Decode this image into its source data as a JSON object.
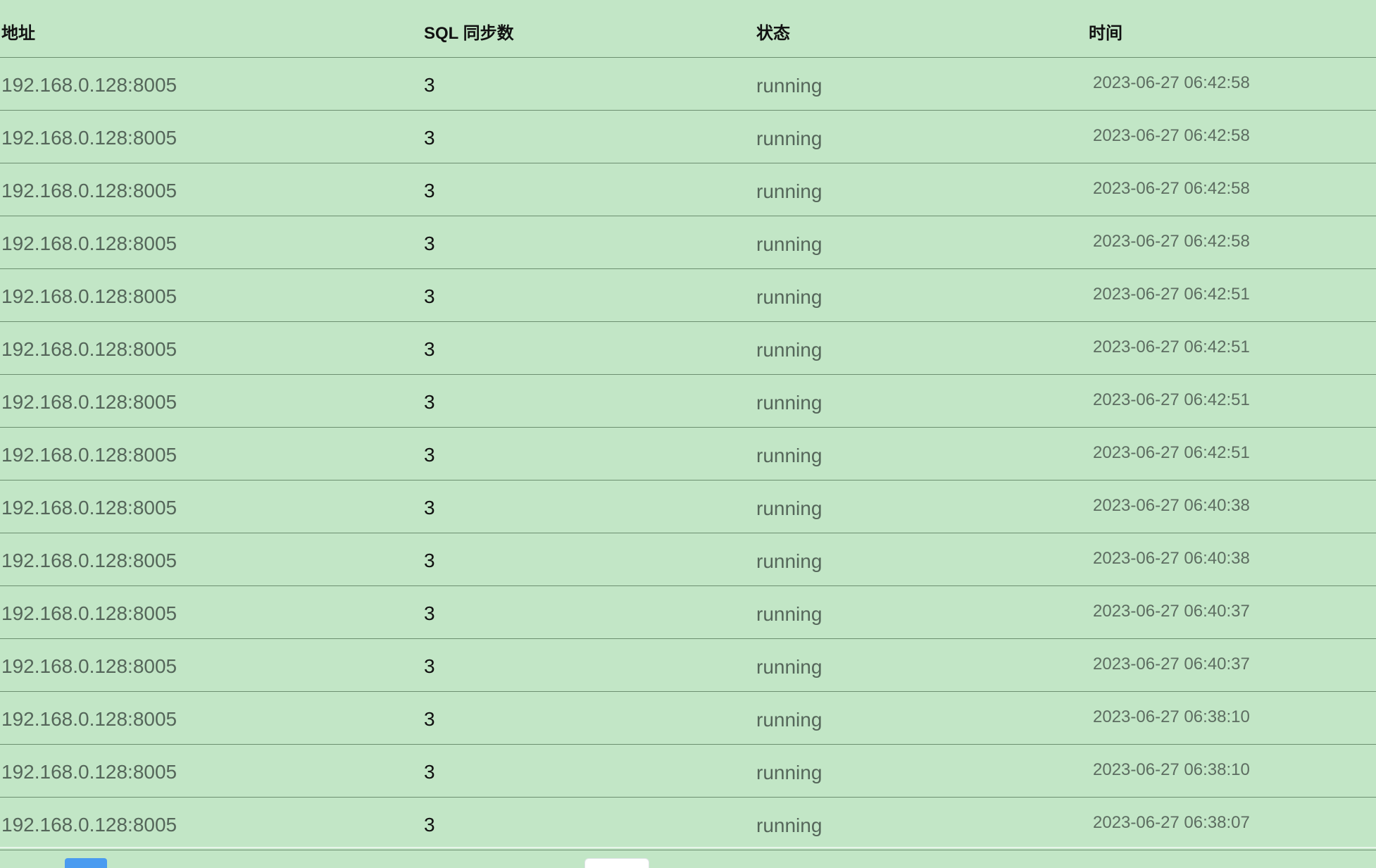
{
  "table": {
    "headers": {
      "address": "地址",
      "sql_sync_count": "SQL 同步数",
      "status": "状态",
      "time": "时间"
    },
    "rows": [
      {
        "address": "192.168.0.128:8005",
        "sql_sync_count": "3",
        "status": "running",
        "time": "2023-06-27 06:42:58"
      },
      {
        "address": "192.168.0.128:8005",
        "sql_sync_count": "3",
        "status": "running",
        "time": "2023-06-27 06:42:58"
      },
      {
        "address": "192.168.0.128:8005",
        "sql_sync_count": "3",
        "status": "running",
        "time": "2023-06-27 06:42:58"
      },
      {
        "address": "192.168.0.128:8005",
        "sql_sync_count": "3",
        "status": "running",
        "time": "2023-06-27 06:42:58"
      },
      {
        "address": "192.168.0.128:8005",
        "sql_sync_count": "3",
        "status": "running",
        "time": "2023-06-27 06:42:51"
      },
      {
        "address": "192.168.0.128:8005",
        "sql_sync_count": "3",
        "status": "running",
        "time": "2023-06-27 06:42:51"
      },
      {
        "address": "192.168.0.128:8005",
        "sql_sync_count": "3",
        "status": "running",
        "time": "2023-06-27 06:42:51"
      },
      {
        "address": "192.168.0.128:8005",
        "sql_sync_count": "3",
        "status": "running",
        "time": "2023-06-27 06:42:51"
      },
      {
        "address": "192.168.0.128:8005",
        "sql_sync_count": "3",
        "status": "running",
        "time": "2023-06-27 06:40:38"
      },
      {
        "address": "192.168.0.128:8005",
        "sql_sync_count": "3",
        "status": "running",
        "time": "2023-06-27 06:40:38"
      },
      {
        "address": "192.168.0.128:8005",
        "sql_sync_count": "3",
        "status": "running",
        "time": "2023-06-27 06:40:37"
      },
      {
        "address": "192.168.0.128:8005",
        "sql_sync_count": "3",
        "status": "running",
        "time": "2023-06-27 06:40:37"
      },
      {
        "address": "192.168.0.128:8005",
        "sql_sync_count": "3",
        "status": "running",
        "time": "2023-06-27 06:38:10"
      },
      {
        "address": "192.168.0.128:8005",
        "sql_sync_count": "3",
        "status": "running",
        "time": "2023-06-27 06:38:10"
      },
      {
        "address": "192.168.0.128:8005",
        "sql_sync_count": "3",
        "status": "running",
        "time": "2023-06-27 06:38:07"
      }
    ]
  },
  "colors": {
    "background": "#c2e6c6",
    "row_border": "#6c8f70",
    "pagination_active": "#4a9bf0"
  }
}
